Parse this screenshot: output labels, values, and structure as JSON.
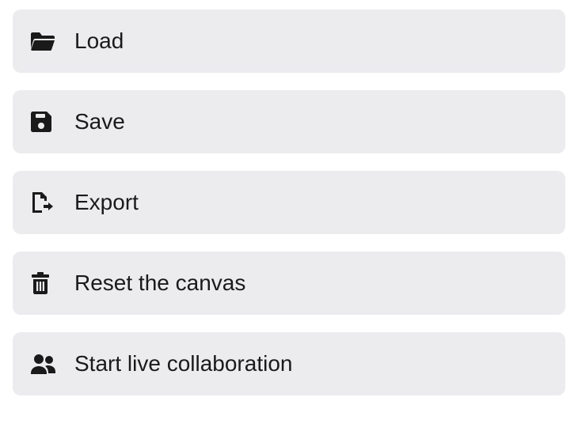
{
  "menu": {
    "items": [
      {
        "id": "load",
        "label": "Load",
        "icon": "folder-open-icon"
      },
      {
        "id": "save",
        "label": "Save",
        "icon": "save-icon"
      },
      {
        "id": "export",
        "label": "Export",
        "icon": "export-icon"
      },
      {
        "id": "reset",
        "label": "Reset the canvas",
        "icon": "trash-icon"
      },
      {
        "id": "collab",
        "label": "Start live collaboration",
        "icon": "users-icon"
      }
    ]
  },
  "colors": {
    "item_bg": "#ececef",
    "text": "#1a1a1a"
  }
}
